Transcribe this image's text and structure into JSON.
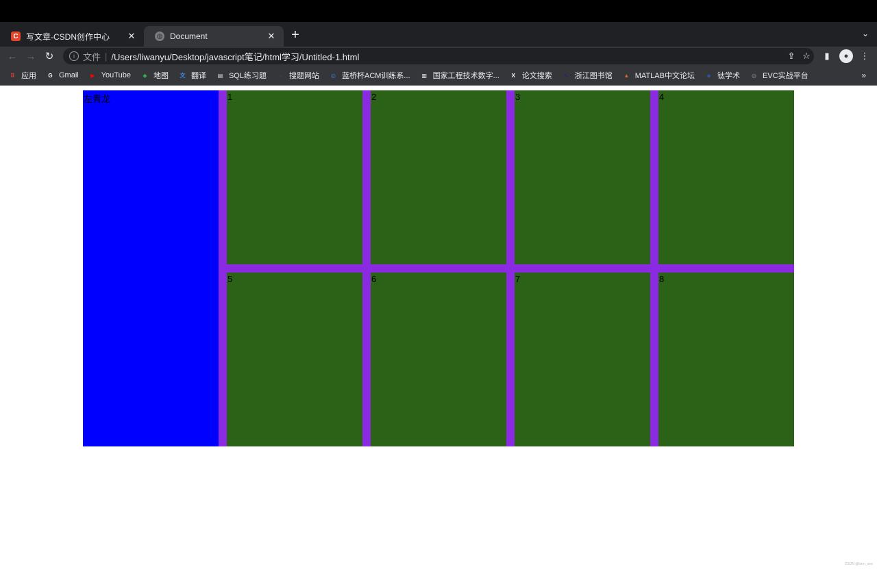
{
  "browser": {
    "tabs": [
      {
        "title": "写文章-CSDN创作中心",
        "icon": "csdn-icon",
        "active": false
      },
      {
        "title": "Document",
        "icon": "globe-icon",
        "active": true
      }
    ],
    "address": {
      "scheme_label": "文件",
      "url": "/Users/liwanyu/Desktop/javascript笔记/html学习/Untitled-1.html"
    },
    "bookmarks": [
      {
        "label": "应用",
        "icon": "apps-grid-icon",
        "color": "#ea4335"
      },
      {
        "label": "Gmail",
        "icon": "google-icon",
        "color": "#ffffff"
      },
      {
        "label": "YouTube",
        "icon": "youtube-icon",
        "color": "#ff0000"
      },
      {
        "label": "地图",
        "icon": "maps-icon",
        "color": "#34a853"
      },
      {
        "label": "翻译",
        "icon": "translate-icon",
        "color": "#4285f4"
      },
      {
        "label": "SQL练习题",
        "icon": "page-icon",
        "color": "#dddddd"
      },
      {
        "label": "搜题网站",
        "icon": "site-icon",
        "color": "#555555"
      },
      {
        "label": "蓝桥杯ACM训练系...",
        "icon": "lanqiao-icon",
        "color": "#3a7bd5"
      },
      {
        "label": "国家工程技术数字...",
        "icon": "chart-page-icon",
        "color": "#ffffff"
      },
      {
        "label": "论文搜索",
        "icon": "xmol-icon",
        "color": "#ffffff"
      },
      {
        "label": "浙江图书馆",
        "icon": "library-icon",
        "color": "#1a237e"
      },
      {
        "label": "MATLAB中文论坛",
        "icon": "matlab-icon",
        "color": "#e16737"
      },
      {
        "label": "钛学术",
        "icon": "graduation-cap-icon",
        "color": "#2b59c3"
      },
      {
        "label": "EVC实战平台",
        "icon": "globe-icon",
        "color": "#7a7b7f"
      }
    ]
  },
  "content": {
    "left_label": "左青龙",
    "cells": [
      "1",
      "2",
      "3",
      "4",
      "5",
      "6",
      "7",
      "8"
    ],
    "colors": {
      "container": "#8a2be2",
      "left": "#0000ff",
      "cell": "#2b6218"
    }
  },
  "watermark": "CSDN @lonn_one"
}
